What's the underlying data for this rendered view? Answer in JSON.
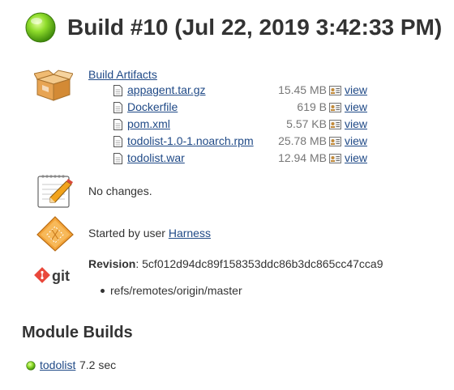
{
  "header": {
    "title": "Build #10 (Jul 22, 2019 3:42:33 PM)",
    "status_icon": "green-ball-icon",
    "status_color": "#6abf1e"
  },
  "artifacts": {
    "heading": "Build Artifacts",
    "icon": "package-box-icon",
    "items": [
      {
        "name": "appagent.tar.gz",
        "size": "15.45 MB",
        "view": "view"
      },
      {
        "name": "Dockerfile",
        "size": "619 B",
        "view": "view"
      },
      {
        "name": "pom.xml",
        "size": "5.57 KB",
        "view": "view"
      },
      {
        "name": "todolist-1.0-1.noarch.rpm",
        "size": "25.78 MB",
        "view": "view"
      },
      {
        "name": "todolist.war",
        "size": "12.94 MB",
        "view": "view"
      }
    ]
  },
  "changes": {
    "icon": "notepad-icon",
    "text": "No changes."
  },
  "cause": {
    "icon": "user-cause-icon",
    "prefix": "Started by user ",
    "user": "Harness"
  },
  "git": {
    "icon": "git-logo-icon",
    "revision_label": "Revision",
    "revision_value": ": 5cf012d94dc89f158353ddc86b3dc865cc47cca9",
    "branch": "refs/remotes/origin/master"
  },
  "modules": {
    "heading": "Module Builds",
    "items": [
      {
        "name": "todolist",
        "duration": "7.2 sec",
        "status_icon": "green-ball-icon"
      }
    ]
  },
  "colors": {
    "link": "#204a87",
    "text": "#333333",
    "size_text": "#777777",
    "success": "#6abf1e"
  }
}
